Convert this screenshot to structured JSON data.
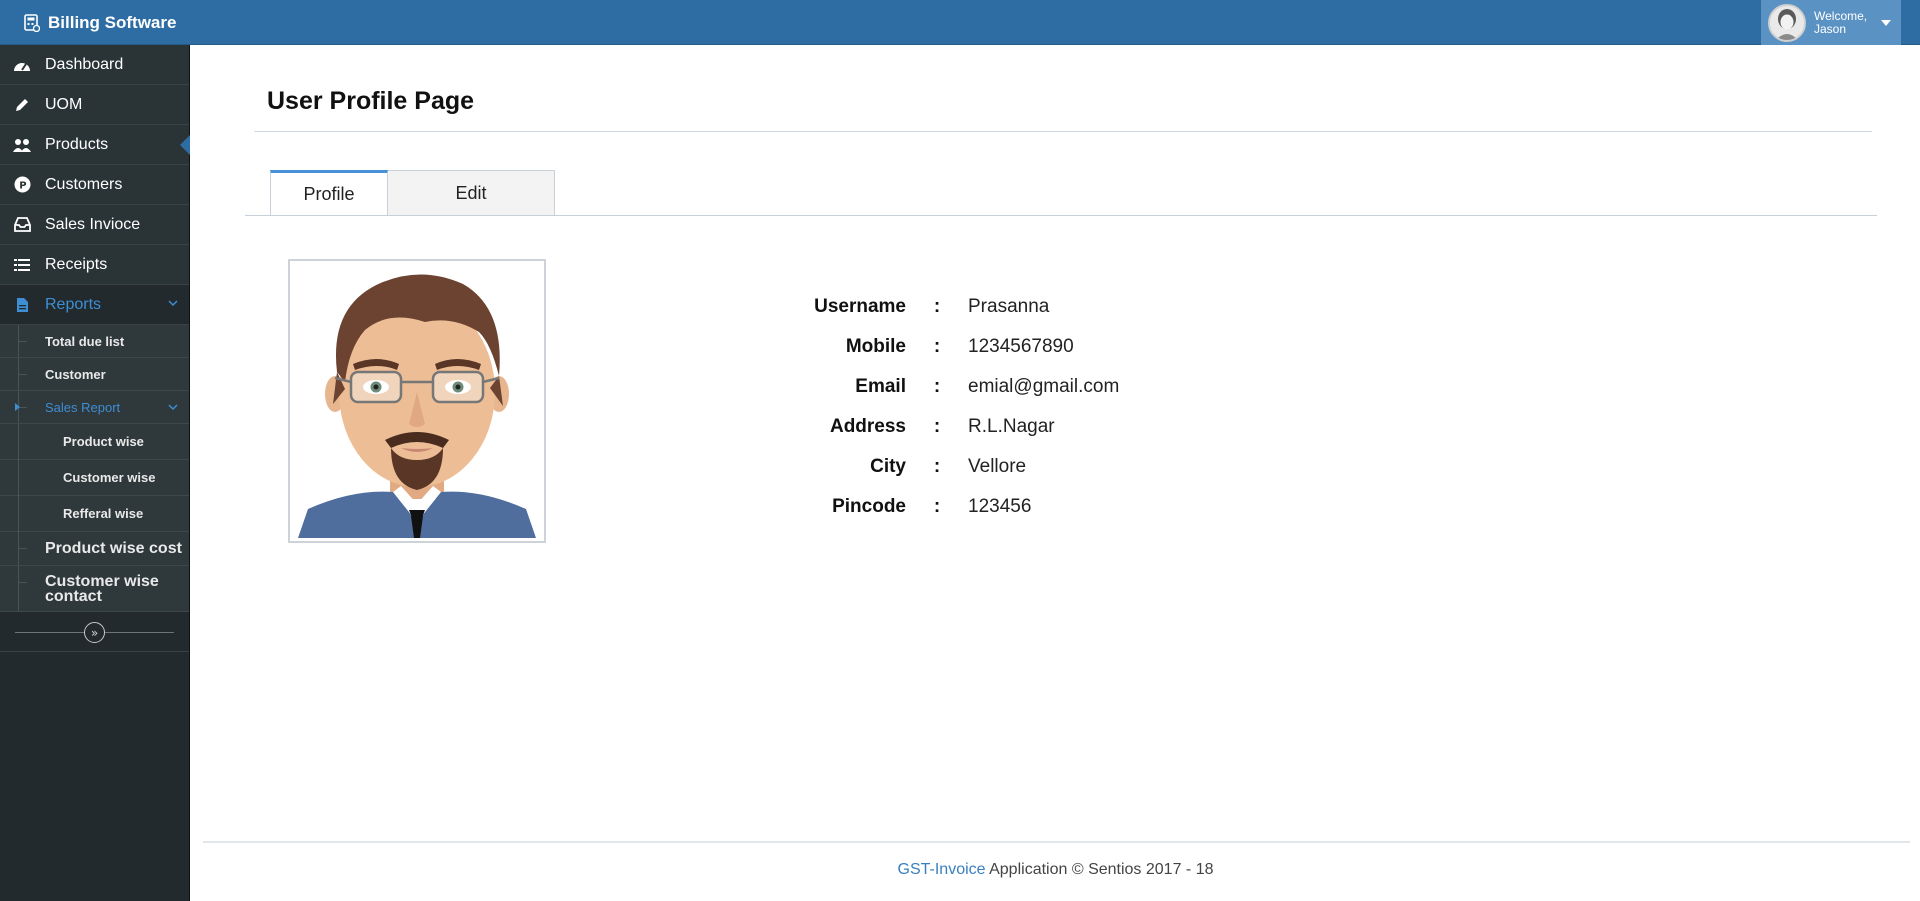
{
  "app": {
    "title": "Billing Software"
  },
  "user": {
    "welcome_label": "Welcome,",
    "name": "Jason"
  },
  "sidebar": {
    "items": [
      {
        "label": "Dashboard",
        "icon": "dashboard-icon"
      },
      {
        "label": "UOM",
        "icon": "pencil-icon"
      },
      {
        "label": "Products",
        "icon": "users-icon"
      },
      {
        "label": "Customers",
        "icon": "p-circle-icon"
      },
      {
        "label": "Sales Invioce",
        "icon": "inbox-icon"
      },
      {
        "label": "Receipts",
        "icon": "list-icon"
      },
      {
        "label": "Reports",
        "icon": "file-icon"
      }
    ],
    "reports_submenu": {
      "total_due": "Total due list",
      "customer": "Customer",
      "sales_report": "Sales Report",
      "sales_report_items": [
        "Product wise",
        "Customer wise",
        "Refferal wise"
      ],
      "product_wise_cost": "Product wise cost",
      "customer_wise_contact": "Customer wise contact"
    }
  },
  "main": {
    "page_title": "User Profile Page",
    "tabs": [
      {
        "label": "Profile"
      },
      {
        "label": "Edit"
      }
    ],
    "profile": [
      {
        "label": "Username",
        "value": "Prasanna"
      },
      {
        "label": "Mobile",
        "value": "1234567890"
      },
      {
        "label": "Email",
        "value": "emial@gmail.com"
      },
      {
        "label": "Address",
        "value": "R.L.Nagar"
      },
      {
        "label": "City",
        "value": "Vellore"
      },
      {
        "label": "Pincode",
        "value": "123456"
      }
    ],
    "colon": ":"
  },
  "footer": {
    "brand": "GST-Invoice",
    "text": " Application © Sentios 2017 - 18"
  },
  "colors": {
    "navbar": "#2e6da3",
    "sidebar": "#222a2d",
    "accent": "#3e8ed4",
    "active_tab_border": "#4a90d9"
  }
}
